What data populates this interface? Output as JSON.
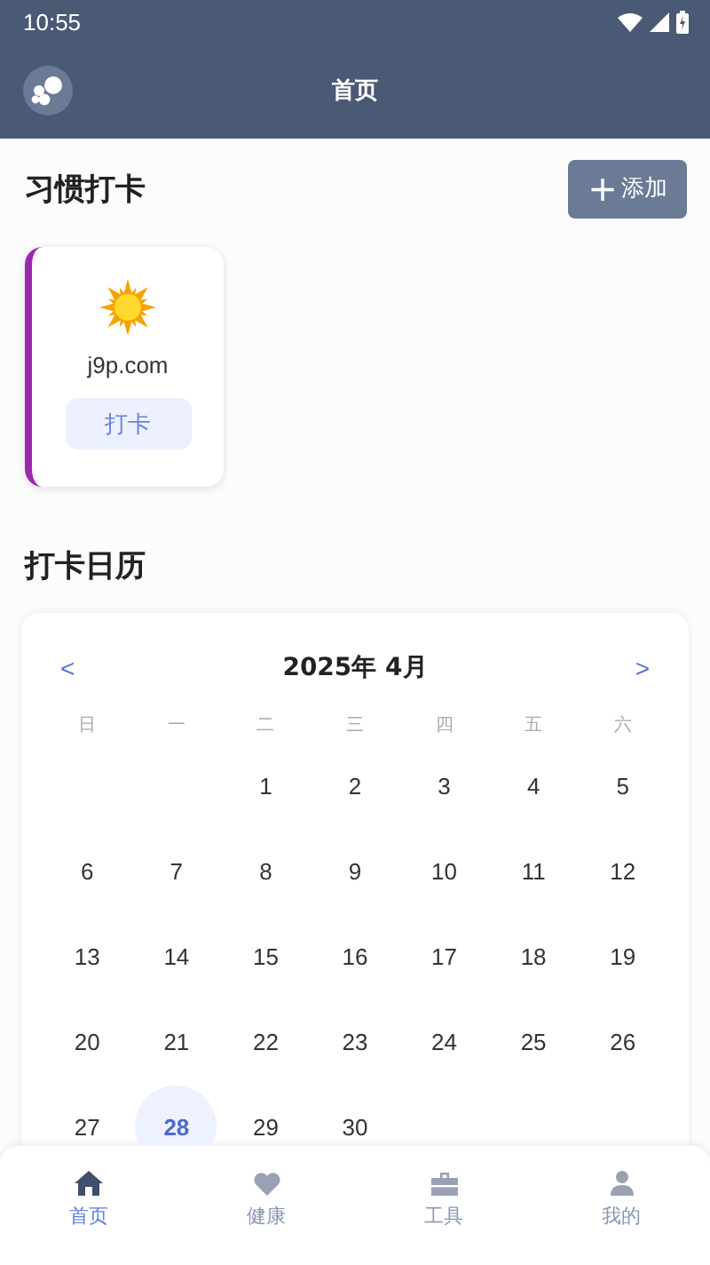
{
  "status_bar": {
    "time": "10:55"
  },
  "app_bar": {
    "title": "首页"
  },
  "habits": {
    "title": "习惯打卡",
    "add_button": {
      "icon": "+",
      "label": "添加"
    },
    "items": [
      {
        "name": "j9p.com",
        "color": "#9c27b0",
        "button": "打卡"
      }
    ]
  },
  "calendar": {
    "title": "打卡日历",
    "prev": "<",
    "next": ">",
    "month": "2025年 4月",
    "weekdays": [
      "日",
      "一",
      "二",
      "三",
      "四",
      "五",
      "六"
    ],
    "cells": [
      {
        "kind": "blank"
      },
      {
        "kind": "blank"
      },
      {
        "kind": "day",
        "day": "1",
        "selected": false
      },
      {
        "kind": "day",
        "day": "2",
        "selected": false
      },
      {
        "kind": "day",
        "day": "3",
        "selected": false
      },
      {
        "kind": "day",
        "day": "4",
        "selected": false
      },
      {
        "kind": "day",
        "day": "5",
        "selected": false
      },
      {
        "kind": "day",
        "day": "6",
        "selected": false
      },
      {
        "kind": "day",
        "day": "7",
        "selected": false
      },
      {
        "kind": "day",
        "day": "8",
        "selected": false
      },
      {
        "kind": "day",
        "day": "9",
        "selected": false
      },
      {
        "kind": "day",
        "day": "10",
        "selected": false
      },
      {
        "kind": "day",
        "day": "11",
        "selected": false
      },
      {
        "kind": "day",
        "day": "12",
        "selected": false
      },
      {
        "kind": "day",
        "day": "13",
        "selected": false
      },
      {
        "kind": "day",
        "day": "14",
        "selected": false
      },
      {
        "kind": "day",
        "day": "15",
        "selected": false
      },
      {
        "kind": "day",
        "day": "16",
        "selected": false
      },
      {
        "kind": "day",
        "day": "17",
        "selected": false
      },
      {
        "kind": "day",
        "day": "18",
        "selected": false
      },
      {
        "kind": "day",
        "day": "19",
        "selected": false
      },
      {
        "kind": "day",
        "day": "20",
        "selected": false
      },
      {
        "kind": "day",
        "day": "21",
        "selected": false
      },
      {
        "kind": "day",
        "day": "22",
        "selected": false
      },
      {
        "kind": "day",
        "day": "23",
        "selected": false
      },
      {
        "kind": "day",
        "day": "24",
        "selected": false
      },
      {
        "kind": "day",
        "day": "25",
        "selected": false
      },
      {
        "kind": "day",
        "day": "26",
        "selected": false
      },
      {
        "kind": "day",
        "day": "27",
        "selected": false
      },
      {
        "kind": "day",
        "day": "28",
        "selected": true
      },
      {
        "kind": "day",
        "day": "29",
        "selected": false
      },
      {
        "kind": "day",
        "day": "30",
        "selected": false
      }
    ]
  },
  "tab_bar": [
    {
      "kind": "home",
      "label": "首页",
      "selected": true
    },
    {
      "kind": "health",
      "label": "健康",
      "selected": false
    },
    {
      "kind": "tools",
      "label": "工具",
      "selected": false
    },
    {
      "kind": "profile",
      "label": "我的",
      "selected": false
    }
  ]
}
